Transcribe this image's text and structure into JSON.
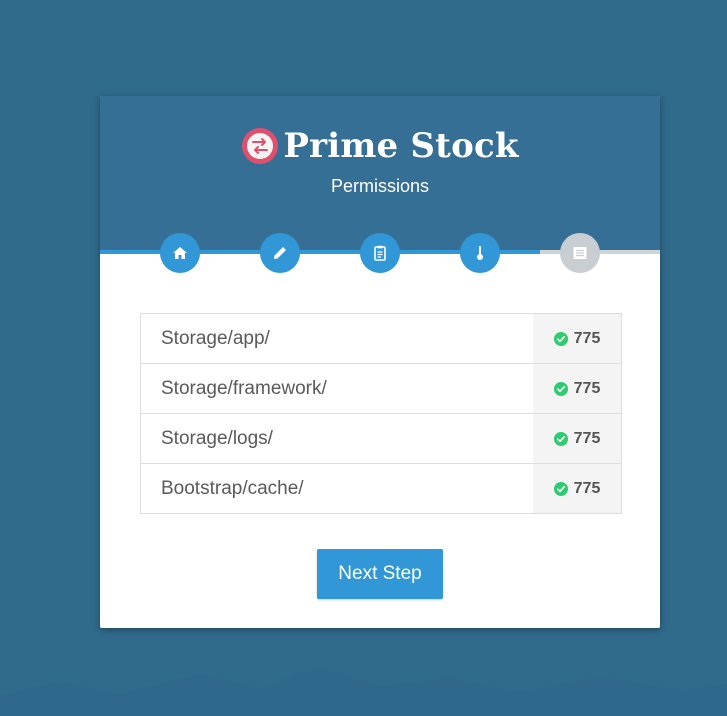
{
  "brand": {
    "name": "Prime Stock",
    "logo_icon": "exchange-arrows-icon",
    "logo_color": "#e0506c"
  },
  "header": {
    "subtitle": "Permissions"
  },
  "steps": [
    {
      "icon": "home-icon",
      "status": "done"
    },
    {
      "icon": "pencil-icon",
      "status": "done"
    },
    {
      "icon": "clipboard-icon",
      "status": "done"
    },
    {
      "icon": "thermometer-icon",
      "status": "done"
    },
    {
      "icon": "list-icon",
      "status": "pending"
    }
  ],
  "permissions": [
    {
      "path": "Storage/app/",
      "value": "775",
      "ok": true
    },
    {
      "path": "Storage/framework/",
      "value": "775",
      "ok": true
    },
    {
      "path": "Storage/logs/",
      "value": "775",
      "ok": true
    },
    {
      "path": "Bootstrap/cache/",
      "value": "775",
      "ok": true
    }
  ],
  "actions": {
    "next_label": "Next Step"
  },
  "colors": {
    "background": "#316b8c",
    "header": "#356f96",
    "accent": "#3197d6",
    "success": "#2ecc71"
  }
}
